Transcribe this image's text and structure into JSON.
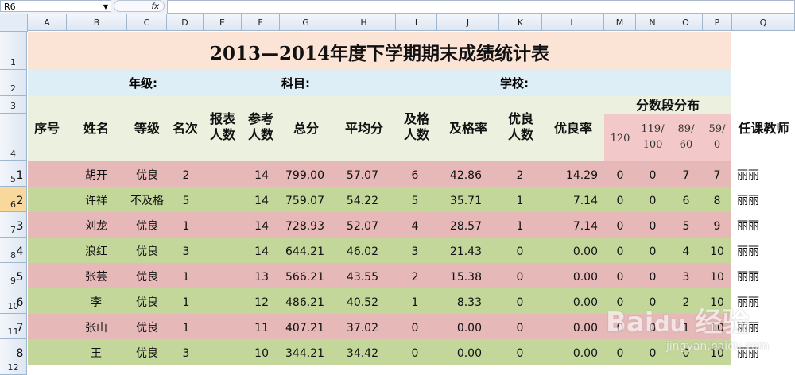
{
  "formula_bar": {
    "name_box": "R6",
    "fx_label": "fx"
  },
  "columns": [
    "A",
    "B",
    "C",
    "D",
    "E",
    "F",
    "G",
    "H",
    "I",
    "J",
    "K",
    "L",
    "M",
    "N",
    "O",
    "P",
    "Q"
  ],
  "rows": [
    "1",
    "2",
    "3",
    "4",
    "5",
    "6",
    "7",
    "8",
    "9",
    "10",
    "11",
    "12"
  ],
  "selected_row": "6",
  "sheet": {
    "title": "2013—2014年度下学期期末成绩统计表",
    "info": {
      "grade_label": "年级:",
      "subject_label": "科目:",
      "school_label": "学校:"
    },
    "headers": {
      "seq": "序号",
      "name": "姓名",
      "level": "等级",
      "rank": "名次",
      "reported_1": "报表",
      "reported_2": "人数",
      "attend_1": "参考",
      "attend_2": "人数",
      "total": "总分",
      "average": "平均分",
      "pass_1": "及格",
      "pass_2": "人数",
      "pass_rate": "及格率",
      "good_1": "优良",
      "good_2": "人数",
      "good_rate": "优良率",
      "dist": "分数段分布",
      "dist_a": "120",
      "dist_b1": "119/",
      "dist_b2": "100",
      "dist_c1": "89/",
      "dist_c2": "60",
      "dist_d1": "59/",
      "dist_d2": "0",
      "teacher": "任课教师"
    },
    "data_rows": [
      {
        "seq": "1",
        "name": "胡开",
        "level": "优良",
        "rank": "2",
        "attend": "14",
        "total": "799.00",
        "avg": "57.07",
        "pass": "6",
        "pass_rate": "42.86",
        "good": "2",
        "good_rate": "14.29",
        "d1": "0",
        "d2": "0",
        "d3": "7",
        "d4": "7",
        "teacher": "丽丽",
        "color": "#e6b8b8"
      },
      {
        "seq": "2",
        "name": "许祥",
        "level": "不及格",
        "rank": "5",
        "attend": "14",
        "total": "759.07",
        "avg": "54.22",
        "pass": "5",
        "pass_rate": "35.71",
        "good": "1",
        "good_rate": "7.14",
        "d1": "0",
        "d2": "0",
        "d3": "6",
        "d4": "8",
        "teacher": "丽丽",
        "color": "#c4d79b"
      },
      {
        "seq": "3",
        "name": "刘龙",
        "level": "优良",
        "rank": "1",
        "attend": "14",
        "total": "728.93",
        "avg": "52.07",
        "pass": "4",
        "pass_rate": "28.57",
        "good": "1",
        "good_rate": "7.14",
        "d1": "0",
        "d2": "0",
        "d3": "5",
        "d4": "9",
        "teacher": "丽丽",
        "color": "#e6b8b8"
      },
      {
        "seq": "4",
        "name": "浪红",
        "level": "优良",
        "rank": "3",
        "attend": "14",
        "total": "644.21",
        "avg": "46.02",
        "pass": "3",
        "pass_rate": "21.43",
        "good": "0",
        "good_rate": "0.00",
        "d1": "0",
        "d2": "0",
        "d3": "4",
        "d4": "10",
        "teacher": "丽丽",
        "color": "#c4d79b"
      },
      {
        "seq": "5",
        "name": "张芸",
        "level": "优良",
        "rank": "1",
        "attend": "13",
        "total": "566.21",
        "avg": "43.55",
        "pass": "2",
        "pass_rate": "15.38",
        "good": "0",
        "good_rate": "0.00",
        "d1": "0",
        "d2": "0",
        "d3": "3",
        "d4": "10",
        "teacher": "丽丽",
        "color": "#e6b8b8"
      },
      {
        "seq": "6",
        "name": "李",
        "level": "优良",
        "rank": "1",
        "attend": "12",
        "total": "486.21",
        "avg": "40.52",
        "pass": "1",
        "pass_rate": "8.33",
        "good": "0",
        "good_rate": "0.00",
        "d1": "0",
        "d2": "0",
        "d3": "2",
        "d4": "10",
        "teacher": "丽丽",
        "color": "#c4d79b"
      },
      {
        "seq": "7",
        "name": "张山",
        "level": "优良",
        "rank": "1",
        "attend": "11",
        "total": "407.21",
        "avg": "37.02",
        "pass": "0",
        "pass_rate": "0.00",
        "good": "0",
        "good_rate": "0.00",
        "d1": "0",
        "d2": "0",
        "d3": "1",
        "d4": "10",
        "teacher": "丽丽",
        "color": "#e6b8b8"
      },
      {
        "seq": "8",
        "name": "王",
        "level": "优良",
        "rank": "3",
        "attend": "10",
        "total": "344.21",
        "avg": "34.42",
        "pass": "0",
        "pass_rate": "0.00",
        "good": "0",
        "good_rate": "0.00",
        "d1": "0",
        "d2": "0",
        "d3": "0",
        "d4": "10",
        "teacher": "丽丽",
        "color": "#c4d79b"
      }
    ]
  },
  "watermark": {
    "logo": "Bai du 经验",
    "url": "jingyan.baidu.com"
  }
}
